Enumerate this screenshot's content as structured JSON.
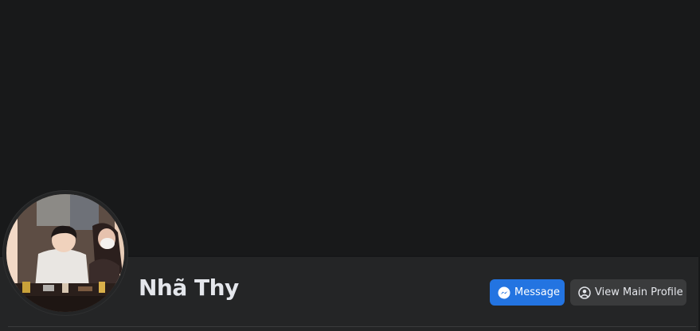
{
  "profile": {
    "name": "Nhã Thy",
    "avatar_alt": "profile-photo"
  },
  "actions": {
    "message_label": "Message",
    "message_icon": "messenger-icon",
    "view_profile_label": "View Main Profile",
    "view_profile_icon": "user-circle-icon"
  },
  "colors": {
    "background": "#18191a",
    "surface": "#242526",
    "primary_button": "#2374e1",
    "secondary_button": "#3a3b3c",
    "text": "#e4e6eb"
  }
}
